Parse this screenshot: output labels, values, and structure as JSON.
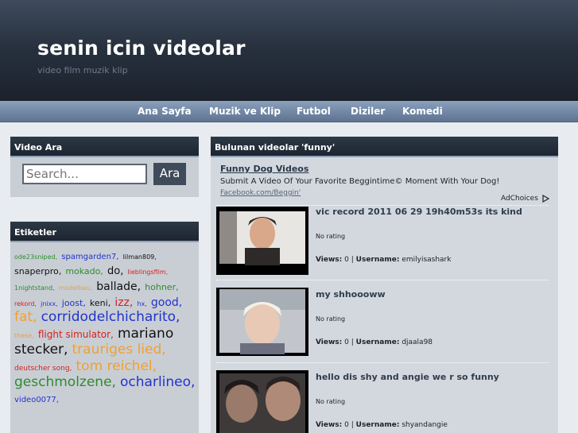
{
  "site": {
    "title": "senin icin videolar",
    "tagline": "video film muzik klip"
  },
  "nav": {
    "items": [
      "Ana Sayfa",
      "Muzik ve Klip",
      "Futbol",
      "Diziler",
      "Komedi"
    ]
  },
  "search_box": {
    "heading": "Video Ara",
    "placeholder": "Search...",
    "button": "Ara"
  },
  "tags_box": {
    "heading": "Etiketler",
    "tags": [
      {
        "text": "ode23sniped,",
        "color": "#2e8b2e",
        "size": 8
      },
      {
        "text": "spamgarden7,",
        "color": "#2233cc",
        "size": 10
      },
      {
        "text": "lilman809,",
        "color": "#111111",
        "size": 8
      },
      {
        "text": "snaperpro,",
        "color": "#111111",
        "size": 11
      },
      {
        "text": "mokado,",
        "color": "#2e8b2e",
        "size": 11
      },
      {
        "text": "do,",
        "color": "#111111",
        "size": 13
      },
      {
        "text": "lieblingsfilm,",
        "color": "#d62020",
        "size": 8
      },
      {
        "text": "1nightstand,",
        "color": "#2e8b2e",
        "size": 8
      },
      {
        "text": "modelbau,",
        "color": "#f0a030",
        "size": 8
      },
      {
        "text": "ballade,",
        "color": "#111111",
        "size": 14
      },
      {
        "text": "hohner,",
        "color": "#2e8b2e",
        "size": 11
      },
      {
        "text": "rekord,",
        "color": "#d62020",
        "size": 8
      },
      {
        "text": "jnixx,",
        "color": "#2233cc",
        "size": 8
      },
      {
        "text": "joost,",
        "color": "#2233cc",
        "size": 11
      },
      {
        "text": "keni,",
        "color": "#111111",
        "size": 11
      },
      {
        "text": "izz,",
        "color": "#d62020",
        "size": 14
      },
      {
        "text": "hx,",
        "color": "#2233cc",
        "size": 8
      },
      {
        "text": "good,",
        "color": "#2233cc",
        "size": 14
      },
      {
        "text": "fat,",
        "color": "#f0a030",
        "size": 17
      },
      {
        "text": "corridodelchicharito,",
        "color": "#2233cc",
        "size": 17
      },
      {
        "text": "these,",
        "color": "#f0a030",
        "size": 8
      },
      {
        "text": "flight simulator,",
        "color": "#d62020",
        "size": 12
      },
      {
        "text": "mariano",
        "color": "#111111",
        "size": 17
      },
      {
        "text": "stecker,",
        "color": "#111111",
        "size": 17
      },
      {
        "text": "trauriges lied,",
        "color": "#f0a030",
        "size": 17
      },
      {
        "text": "deutscher song,",
        "color": "#d62020",
        "size": 9
      },
      {
        "text": "tom reichel,",
        "color": "#f0a030",
        "size": 17
      },
      {
        "text": "geschmolzene,",
        "color": "#2e8b2e",
        "size": 17
      },
      {
        "text": "ocharlineo,",
        "color": "#2233cc",
        "size": 17
      },
      {
        "text": "video0077,",
        "color": "#2233cc",
        "size": 10
      }
    ]
  },
  "results": {
    "heading": "Bulunan videolar 'funny'",
    "ad": {
      "title": "Funny Dog Videos",
      "text": "Submit A Video Of Your Favorite Beggintime© Moment With Your Dog!",
      "url": "Facebook.com/Beggin'",
      "choices": "AdChoices"
    },
    "videos": [
      {
        "title": "vic record 2011 06 29 19h40m53s its kind",
        "rating": "No rating",
        "views_label": "Views:",
        "views": "0",
        "username_label": "Username:",
        "username": "emilyisashark"
      },
      {
        "title": "my shhoooww",
        "rating": "No rating",
        "views_label": "Views:",
        "views": "0",
        "username_label": "Username:",
        "username": "djaala98"
      },
      {
        "title": "hello dis shy and angie we r so funny",
        "rating": "No rating",
        "views_label": "Views:",
        "views": "0",
        "username_label": "Username:",
        "username": "shyandangie"
      }
    ]
  },
  "colors": {
    "header_dark": "#1b222c",
    "nav_blue": "#7088a6",
    "box_head": "#253040",
    "tag_blue": "#2233cc",
    "tag_green": "#2e8b2e",
    "tag_red": "#d62020",
    "tag_orange": "#f0a030"
  }
}
